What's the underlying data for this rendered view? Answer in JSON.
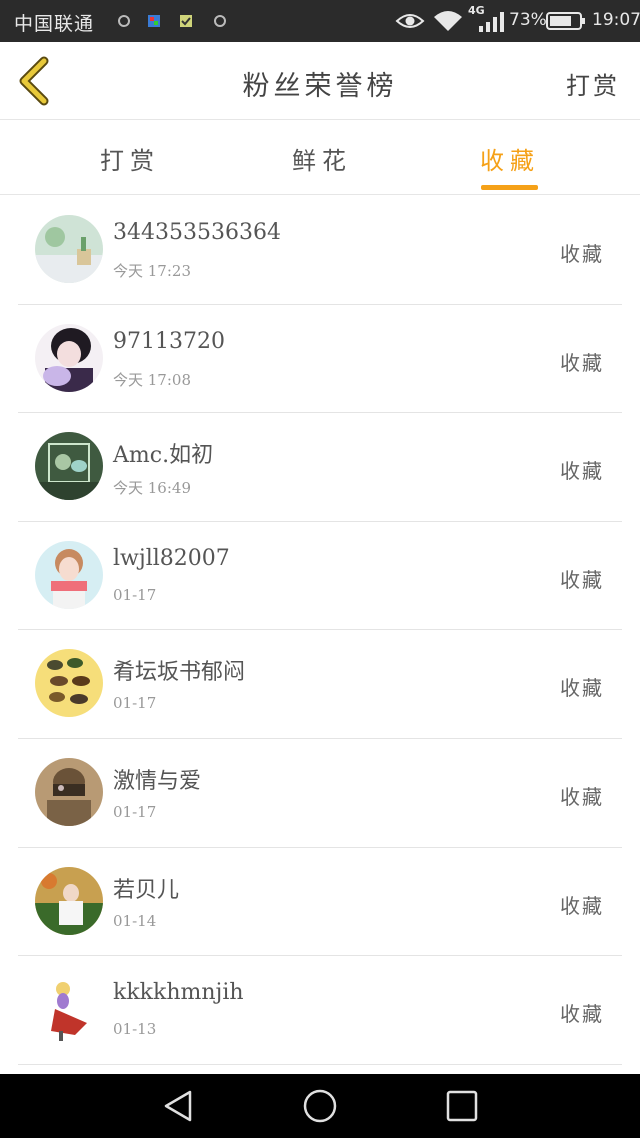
{
  "status_bar": {
    "carrier": "中国联通",
    "network": "4G",
    "battery": "73%",
    "time": "19:07"
  },
  "header": {
    "title": "粉丝荣誉榜",
    "action_label": "打赏"
  },
  "tabs": [
    {
      "label": "打赏",
      "active": false
    },
    {
      "label": "鲜花",
      "active": false
    },
    {
      "label": "收藏",
      "active": true
    }
  ],
  "fans": [
    {
      "name": "344353536364",
      "time": "今天 17:23",
      "action": "收藏"
    },
    {
      "name": "97113720",
      "time": "今天 17:08",
      "action": "收藏"
    },
    {
      "name": "Amc.如初",
      "time": "今天 16:49",
      "action": "收藏"
    },
    {
      "name": "lwjll82007",
      "time": "01-17",
      "action": "收藏"
    },
    {
      "name": "肴坛坂书郁闷",
      "time": "01-17",
      "action": "收藏"
    },
    {
      "name": "激情与爱",
      "time": "01-17",
      "action": "收藏"
    },
    {
      "name": "若贝儿",
      "time": "01-14",
      "action": "收藏"
    },
    {
      "name": "kkkkhmnjih",
      "time": "01-13",
      "action": "收藏"
    }
  ],
  "colors": {
    "accent": "#f5a118",
    "status_bar": "#2b2b2b",
    "nav_bar": "#000000"
  },
  "icons": {
    "back": "chevron-left-icon",
    "nav_back": "triangle-back-icon",
    "nav_home": "circle-home-icon",
    "nav_recent": "square-recent-icon"
  }
}
